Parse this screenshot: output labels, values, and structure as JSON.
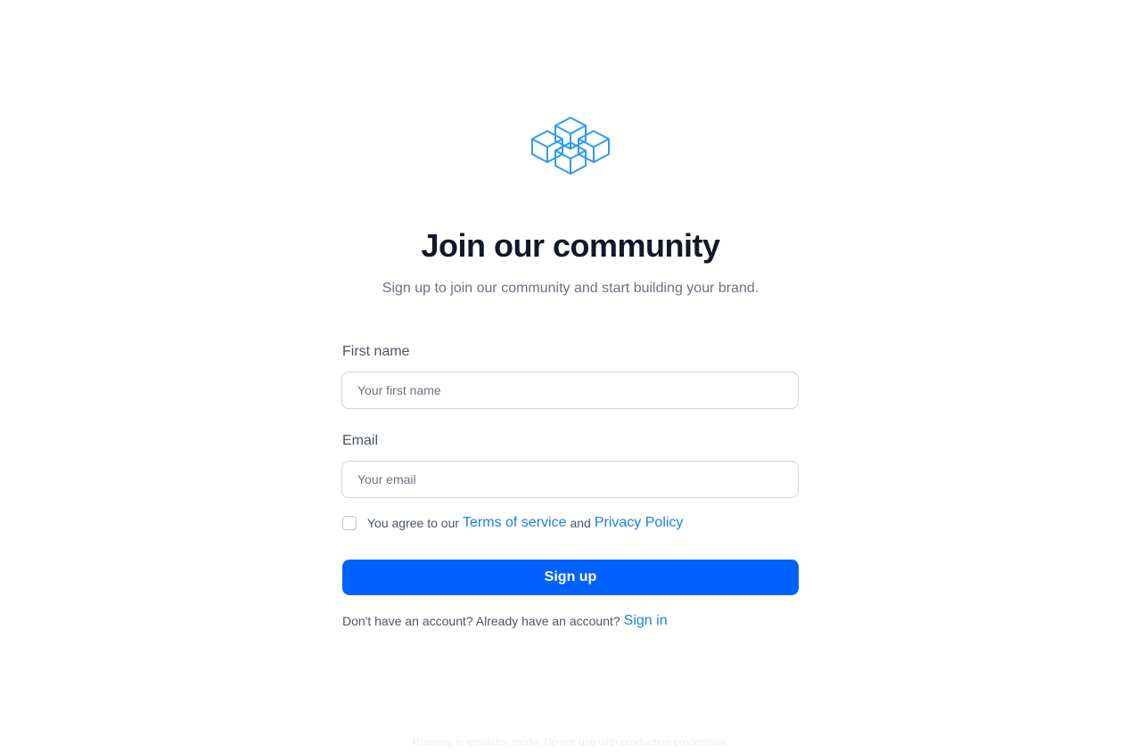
{
  "header": {
    "logo_icon": "cubes-logo-icon",
    "title": "Join our community",
    "subtitle": "Sign up to join our community and start building your brand."
  },
  "form": {
    "first_name": {
      "label": "First name",
      "value": "",
      "placeholder": "Your first name"
    },
    "email": {
      "label": "Email",
      "value": "",
      "placeholder": "Your email"
    },
    "terms": {
      "checked": false,
      "prefix": "You agree to our",
      "terms_link": "Terms of service",
      "conjunction": "and",
      "privacy_link": "Privacy Policy"
    },
    "submit_label": "Sign up"
  },
  "signin": {
    "prompt": "Don't have an account? Already have an account?",
    "link": "Sign in"
  },
  "footer": {
    "notice": "Running in emulator mode. Do not use with production credentials."
  },
  "colors": {
    "accent": "#0061ff",
    "link": "#1a7fe6",
    "logo": "#2e9bf0"
  }
}
